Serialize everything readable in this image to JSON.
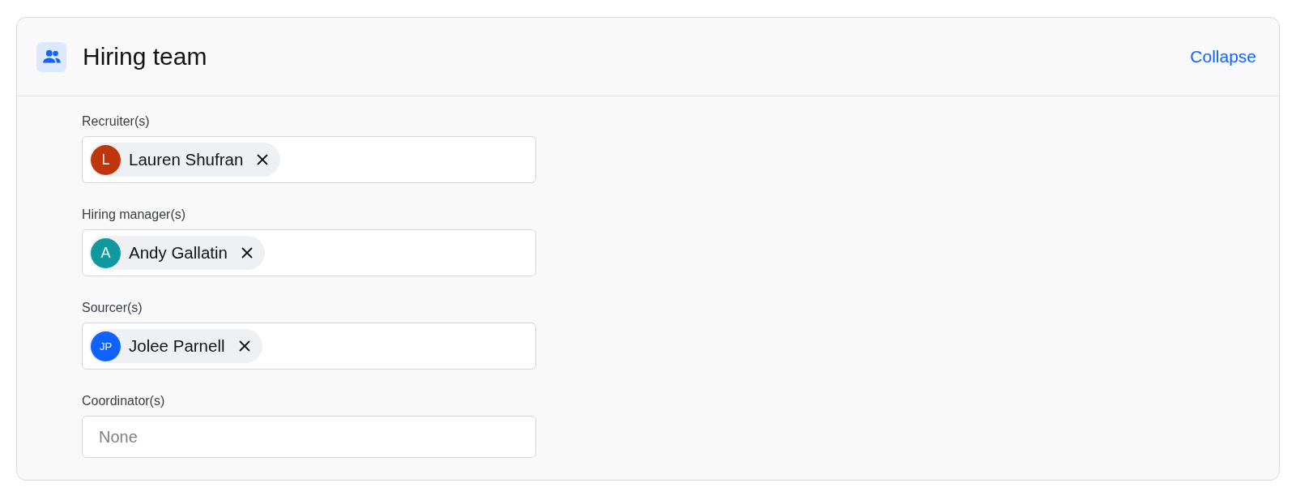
{
  "section": {
    "title": "Hiring team",
    "action": "Collapse"
  },
  "fields": [
    {
      "label": "Recruiter(s)",
      "people": [
        {
          "initials": "L",
          "name": "Lauren Shufran",
          "color": "#bf360c"
        }
      ]
    },
    {
      "label": "Hiring manager(s)",
      "people": [
        {
          "initials": "A",
          "name": "Andy Gallatin",
          "color": "#0f9a9f"
        }
      ]
    },
    {
      "label": "Sourcer(s)",
      "people": [
        {
          "initials": "JP",
          "name": "Jolee Parnell",
          "color": "#0f62fe"
        }
      ]
    },
    {
      "label": "Coordinator(s)",
      "placeholder": "None"
    }
  ]
}
